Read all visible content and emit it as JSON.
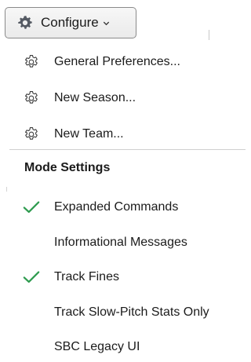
{
  "toolbar": {
    "configure_label": "Configure",
    "configure_icon": "gear-icon",
    "dropdown_icon": "chevron-down-icon"
  },
  "menu": {
    "commands": [
      {
        "label": "General Preferences...",
        "icon": "settings-gear-icon"
      },
      {
        "label": "New Season...",
        "icon": "settings-gear-icon"
      },
      {
        "label": "New Team...",
        "icon": "settings-gear-icon"
      }
    ],
    "mode_settings": {
      "header": "Mode Settings",
      "items": [
        {
          "label": "Expanded Commands",
          "checked": true
        },
        {
          "label": "Informational Messages",
          "checked": false
        },
        {
          "label": "Track Fines",
          "checked": true
        },
        {
          "label": "Track Slow-Pitch Stats Only",
          "checked": false
        },
        {
          "label": "SBC Legacy UI",
          "checked": false
        }
      ]
    }
  },
  "colors": {
    "checkmark": "#2e9b4f",
    "gear_fill": "#555a63",
    "divider": "#cfcfcf"
  }
}
